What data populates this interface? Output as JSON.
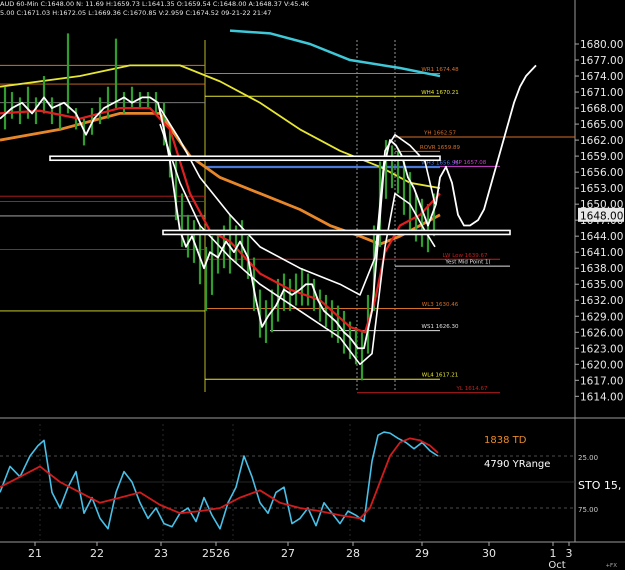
{
  "header": {
    "line1": "AUD 60-Min  C:1648.00  N:  11.69  H:1659.73  L:1641.35  O:1659.54  C:1648.00  A:1648.37  V:45.4K",
    "line2": "5.00  C:1671.03  H:1672.05  L:1669.36  C:1670.85  V:2.959  C:1674.52  09-21-22  21:47"
  },
  "colors": {
    "background": "#000000",
    "candle": "#2f9e2f",
    "price_line": "#ffffff",
    "ma_red": "#e02020",
    "ma_orange": "#e8862a",
    "ma_yellow": "#e6e635",
    "ma_cyan": "#3ec8d8",
    "stoch_cyan": "#48c0e8",
    "stoch_red": "#d01c1c",
    "level_orange": "#d4702a",
    "level_yellow": "#e6e635",
    "level_red": "#c02020",
    "level_blue": "#4a78d8",
    "current_price_box": "#e8e8e8"
  },
  "chart_data": [
    {
      "type": "candlestick",
      "title": "",
      "ylim": [
        1612,
        1683
      ],
      "y_axis_ticks": [
        "1614.00",
        "1617.00",
        "1620.00",
        "1623.00",
        "1626.00",
        "1629.00",
        "1632.00",
        "1635.00",
        "1638.00",
        "1641.00",
        "1644.00",
        "1647.00",
        "1650.00",
        "1653.00",
        "1656.00",
        "1659.00",
        "1662.00",
        "1665.00",
        "1668.00",
        "1671.00",
        "1674.00",
        "1677.00",
        "1680.00"
      ],
      "current_price": "1648.00",
      "x_axis_labels": [
        "21",
        "22",
        "23",
        "2526",
        "27",
        "28",
        "29",
        "30",
        "1",
        "3"
      ],
      "x_axis_sublabel": "Oct",
      "levels": [
        {
          "label": "WR1 1674.48",
          "value": 1674.48,
          "color": "orange"
        },
        {
          "label": "WH4 1670.21",
          "value": 1670.21,
          "color": "yellow"
        },
        {
          "label": "YH 1662.57",
          "value": 1662.57,
          "color": "orange"
        },
        {
          "label": "ROVR 1659.89",
          "value": 1659.89,
          "color": "orange"
        },
        {
          "label": "WH3 1656.96",
          "value": 1656.96,
          "color": "blue"
        },
        {
          "label": "MP 1657.08",
          "value": 1657.08,
          "color": "magenta"
        },
        {
          "label": "LW Low 1639.67",
          "value": 1639.67,
          "color": "red"
        },
        {
          "label": "Yest Mid Point 1(",
          "value": 1638.4,
          "color": "white"
        },
        {
          "label": "WL3 1630.46",
          "value": 1630.46,
          "color": "orange"
        },
        {
          "label": "WS1 1626.30",
          "value": 1626.3,
          "color": "white"
        },
        {
          "label": "WL4 1617.21",
          "value": 1617.21,
          "color": "yellow"
        },
        {
          "label": "YL 1614.67",
          "value": 1614.67,
          "color": "red"
        }
      ],
      "price_path": [
        [
          0,
          1666
        ],
        [
          12,
          1668
        ],
        [
          22,
          1669
        ],
        [
          32,
          1667
        ],
        [
          44,
          1670
        ],
        [
          52,
          1668
        ],
        [
          64,
          1669
        ],
        [
          76,
          1667
        ],
        [
          86,
          1663
        ],
        [
          94,
          1666
        ],
        [
          104,
          1668
        ],
        [
          114,
          1669
        ],
        [
          124,
          1670
        ],
        [
          132,
          1669
        ],
        [
          142,
          1670
        ],
        [
          150,
          1670
        ],
        [
          158,
          1669
        ],
        [
          164,
          1664
        ],
        [
          170,
          1658
        ],
        [
          176,
          1650
        ],
        [
          180,
          1645
        ],
        [
          186,
          1642
        ],
        [
          192,
          1644
        ],
        [
          198,
          1641
        ],
        [
          204,
          1638
        ],
        [
          210,
          1641
        ],
        [
          218,
          1640
        ],
        [
          226,
          1643
        ],
        [
          234,
          1641
        ],
        [
          240,
          1643
        ],
        [
          248,
          1640
        ],
        [
          256,
          1632
        ],
        [
          262,
          1627
        ],
        [
          268,
          1629
        ],
        [
          276,
          1631
        ],
        [
          284,
          1634
        ],
        [
          292,
          1633
        ],
        [
          300,
          1634
        ],
        [
          306,
          1635
        ],
        [
          312,
          1635
        ],
        [
          318,
          1632
        ],
        [
          324,
          1630
        ],
        [
          330,
          1629
        ],
        [
          336,
          1628
        ],
        [
          344,
          1626
        ],
        [
          350,
          1625
        ],
        [
          358,
          1623
        ],
        [
          364,
          1623
        ],
        [
          372,
          1630
        ],
        [
          378,
          1643
        ],
        [
          384,
          1657
        ],
        [
          390,
          1662
        ],
        [
          396,
          1661
        ],
        [
          402,
          1659
        ],
        [
          408,
          1655
        ],
        [
          414,
          1653
        ],
        [
          420,
          1650
        ],
        [
          424,
          1648
        ],
        [
          428,
          1646
        ],
        [
          432,
          1648
        ],
        [
          436,
          1650
        ],
        [
          440,
          1655
        ],
        [
          446,
          1657
        ],
        [
          452,
          1654
        ],
        [
          458,
          1648
        ],
        [
          464,
          1646
        ],
        [
          470,
          1646
        ],
        [
          478,
          1647
        ],
        [
          484,
          1649
        ],
        [
          490,
          1653
        ],
        [
          496,
          1657
        ],
        [
          502,
          1661
        ],
        [
          508,
          1665
        ],
        [
          514,
          1669
        ],
        [
          520,
          1672
        ],
        [
          526,
          1674
        ],
        [
          536,
          1676
        ]
      ],
      "ma_red": [
        [
          0,
          1667
        ],
        [
          40,
          1667.5
        ],
        [
          80,
          1666
        ],
        [
          120,
          1668
        ],
        [
          150,
          1668
        ],
        [
          170,
          1664
        ],
        [
          190,
          1652
        ],
        [
          210,
          1645
        ],
        [
          230,
          1643
        ],
        [
          260,
          1637
        ],
        [
          290,
          1634
        ],
        [
          320,
          1632
        ],
        [
          350,
          1627
        ],
        [
          365,
          1626
        ],
        [
          375,
          1632
        ],
        [
          385,
          1641
        ],
        [
          400,
          1646
        ],
        [
          420,
          1648
        ],
        [
          440,
          1652
        ]
      ],
      "ma_orange": [
        [
          0,
          1662
        ],
        [
          60,
          1664
        ],
        [
          120,
          1667
        ],
        [
          160,
          1667
        ],
        [
          190,
          1659
        ],
        [
          220,
          1655
        ],
        [
          260,
          1652
        ],
        [
          300,
          1649
        ],
        [
          330,
          1646
        ],
        [
          360,
          1644
        ],
        [
          380,
          1642.5
        ],
        [
          400,
          1644
        ],
        [
          420,
          1646
        ],
        [
          440,
          1648
        ]
      ],
      "ma_yellow": [
        [
          0,
          1672
        ],
        [
          80,
          1674
        ],
        [
          130,
          1676
        ],
        [
          180,
          1676
        ],
        [
          220,
          1673
        ],
        [
          260,
          1669
        ],
        [
          300,
          1664
        ],
        [
          340,
          1660
        ],
        [
          380,
          1657
        ],
        [
          410,
          1654
        ],
        [
          440,
          1653
        ]
      ],
      "ma_cyan": [
        [
          230,
          1682.5
        ],
        [
          270,
          1682
        ],
        [
          310,
          1680
        ],
        [
          350,
          1677
        ],
        [
          400,
          1675.5
        ],
        [
          440,
          1674
        ]
      ],
      "candles": [
        [
          5,
          1664,
          1672
        ],
        [
          12,
          1666,
          1671
        ],
        [
          20,
          1665,
          1670
        ],
        [
          28,
          1666,
          1672
        ],
        [
          36,
          1665,
          1670
        ],
        [
          44,
          1667,
          1674
        ],
        [
          52,
          1665,
          1670
        ],
        [
          60,
          1664,
          1669
        ],
        [
          68,
          1667,
          1682
        ],
        [
          76,
          1664,
          1668
        ],
        [
          84,
          1661,
          1666
        ],
        [
          92,
          1663,
          1668
        ],
        [
          100,
          1665,
          1670
        ],
        [
          108,
          1666,
          1672
        ],
        [
          116,
          1668,
          1681
        ],
        [
          124,
          1667,
          1671
        ],
        [
          132,
          1668,
          1672
        ],
        [
          140,
          1668,
          1671
        ],
        [
          148,
          1668,
          1671
        ],
        [
          156,
          1667,
          1671
        ],
        [
          164,
          1661,
          1669
        ],
        [
          170,
          1655,
          1664
        ],
        [
          176,
          1647,
          1659
        ],
        [
          182,
          1642,
          1652
        ],
        [
          188,
          1640,
          1648
        ],
        [
          194,
          1639,
          1647
        ],
        [
          200,
          1635,
          1646
        ],
        [
          206,
          1630,
          1642
        ],
        [
          212,
          1633,
          1644
        ],
        [
          218,
          1637,
          1645
        ],
        [
          224,
          1638,
          1646
        ],
        [
          230,
          1637,
          1648
        ],
        [
          236,
          1639,
          1646
        ],
        [
          242,
          1638,
          1647
        ],
        [
          248,
          1636,
          1644
        ],
        [
          254,
          1630,
          1640
        ],
        [
          260,
          1625,
          1634
        ],
        [
          266,
          1624,
          1632
        ],
        [
          272,
          1626,
          1634
        ],
        [
          278,
          1628,
          1636
        ],
        [
          284,
          1630,
          1637
        ],
        [
          290,
          1630,
          1636
        ],
        [
          296,
          1631,
          1637
        ],
        [
          302,
          1631,
          1638
        ],
        [
          308,
          1631,
          1637
        ],
        [
          314,
          1630,
          1636
        ],
        [
          320,
          1628,
          1634
        ],
        [
          326,
          1627,
          1633
        ],
        [
          332,
          1625,
          1632
        ],
        [
          338,
          1624,
          1631
        ],
        [
          344,
          1622,
          1630
        ],
        [
          350,
          1621,
          1628
        ],
        [
          356,
          1620,
          1627
        ],
        [
          362,
          1617,
          1626
        ],
        [
          368,
          1622,
          1633
        ],
        [
          374,
          1630,
          1646
        ],
        [
          380,
          1642,
          1658
        ],
        [
          386,
          1651,
          1662
        ],
        [
          392,
          1653,
          1661
        ],
        [
          398,
          1652,
          1660
        ],
        [
          404,
          1648,
          1658
        ],
        [
          410,
          1645,
          1656
        ],
        [
          416,
          1643,
          1652
        ],
        [
          422,
          1642,
          1651
        ],
        [
          428,
          1641,
          1650
        ],
        [
          434,
          1644,
          1652
        ]
      ]
    },
    {
      "type": "line",
      "title": "",
      "ylim": [
        0,
        100
      ],
      "y_axis_ticks": [
        "25.00",
        "75.00"
      ],
      "annotations": [
        "1838 TD",
        "4790 YRange"
      ],
      "axis_label": "STO  15,",
      "series": [
        {
          "color": "cyan",
          "values": [
            [
              0,
              60
            ],
            [
              10,
              35
            ],
            [
              20,
              45
            ],
            [
              30,
              25
            ],
            [
              38,
              15
            ],
            [
              44,
              10
            ],
            [
              52,
              60
            ],
            [
              60,
              75
            ],
            [
              68,
              55
            ],
            [
              76,
              40
            ],
            [
              84,
              80
            ],
            [
              92,
              65
            ],
            [
              100,
              85
            ],
            [
              108,
              95
            ],
            [
              116,
              60
            ],
            [
              124,
              40
            ],
            [
              132,
              50
            ],
            [
              140,
              70
            ],
            [
              148,
              85
            ],
            [
              156,
              75
            ],
            [
              164,
              90
            ],
            [
              172,
              93
            ],
            [
              180,
              80
            ],
            [
              188,
              75
            ],
            [
              196,
              88
            ],
            [
              204,
              65
            ],
            [
              212,
              82
            ],
            [
              220,
              95
            ],
            [
              228,
              70
            ],
            [
              236,
              55
            ],
            [
              244,
              25
            ],
            [
              252,
              45
            ],
            [
              260,
              70
            ],
            [
              268,
              80
            ],
            [
              276,
              60
            ],
            [
              284,
              55
            ],
            [
              292,
              90
            ],
            [
              300,
              85
            ],
            [
              308,
              75
            ],
            [
              316,
              92
            ],
            [
              324,
              70
            ],
            [
              332,
              80
            ],
            [
              340,
              90
            ],
            [
              348,
              78
            ],
            [
              356,
              82
            ],
            [
              364,
              88
            ],
            [
              372,
              30
            ],
            [
              378,
              5
            ],
            [
              384,
              2
            ],
            [
              390,
              3
            ],
            [
              398,
              8
            ],
            [
              406,
              12
            ],
            [
              414,
              18
            ],
            [
              422,
              12
            ],
            [
              430,
              20
            ],
            [
              438,
              25
            ]
          ]
        },
        {
          "color": "red",
          "values": [
            [
              0,
              55
            ],
            [
              20,
              45
            ],
            [
              40,
              35
            ],
            [
              60,
              50
            ],
            [
              80,
              60
            ],
            [
              100,
              70
            ],
            [
              120,
              65
            ],
            [
              140,
              60
            ],
            [
              160,
              72
            ],
            [
              180,
              80
            ],
            [
              200,
              78
            ],
            [
              220,
              75
            ],
            [
              240,
              65
            ],
            [
              260,
              58
            ],
            [
              280,
              70
            ],
            [
              300,
              75
            ],
            [
              320,
              78
            ],
            [
              340,
              82
            ],
            [
              360,
              85
            ],
            [
              370,
              75
            ],
            [
              380,
              50
            ],
            [
              390,
              25
            ],
            [
              400,
              12
            ],
            [
              410,
              8
            ],
            [
              420,
              10
            ],
            [
              430,
              15
            ],
            [
              438,
              22
            ]
          ]
        }
      ]
    }
  ],
  "status": {
    "fx_label": "+FX"
  }
}
